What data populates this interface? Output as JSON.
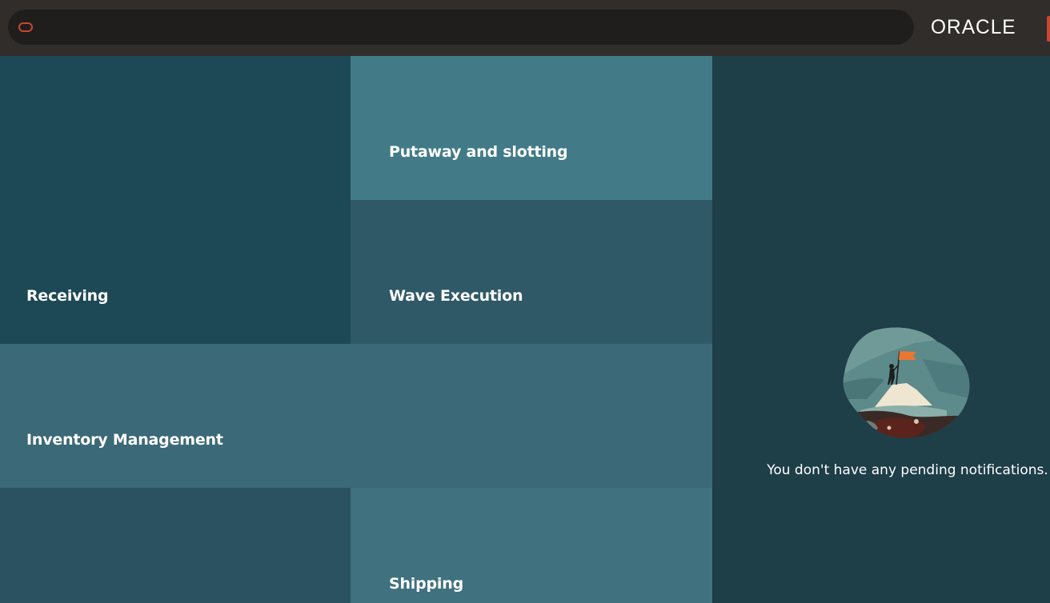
{
  "header": {
    "search": {
      "value": "",
      "placeholder": ""
    },
    "brand": "ORACLE",
    "search_logo_icon": "oracle-o-icon"
  },
  "tiles": [
    {
      "label": "Receiving"
    },
    {
      "label": "Putaway and slotting"
    },
    {
      "label": "Wave Execution"
    },
    {
      "label": "Inventory Management"
    },
    {
      "label": ""
    },
    {
      "label": "Shipping"
    }
  ],
  "notifications": {
    "message": "You don't have any pending notifications.",
    "illustration": "mountain-flag-illustration"
  },
  "colors": {
    "header_bg": "#312d2a",
    "search_bg": "#201e1c",
    "accent": "#c74634",
    "notifications_bg": "#1e3e48"
  }
}
